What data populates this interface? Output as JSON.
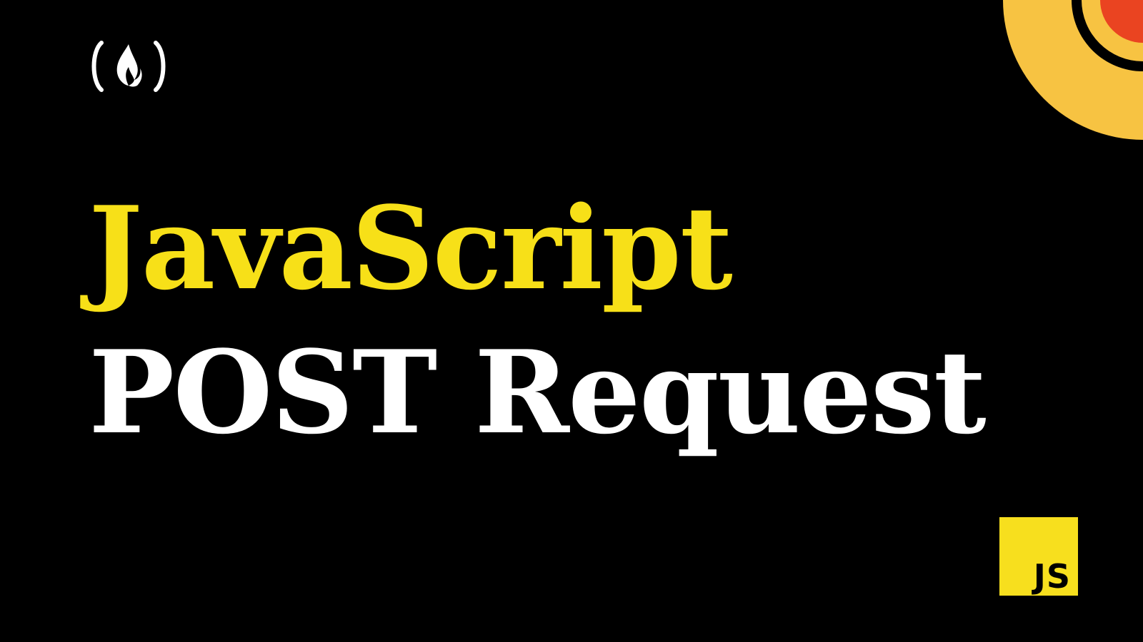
{
  "brand": {
    "logo_icon": "freecodecamp-logo-icon"
  },
  "headline": {
    "line1": "JavaScript",
    "line2": "POST Request"
  },
  "badge": {
    "label": "JS",
    "icon": "javascript-badge-icon"
  },
  "colors": {
    "background": "#000000",
    "title_accent": "#F7E018",
    "title_primary": "#FFFFFF",
    "badge_bg": "#F7DF1E",
    "badge_text": "#000000",
    "deco_orange": "#F7C342",
    "deco_red": "#EA4421"
  }
}
